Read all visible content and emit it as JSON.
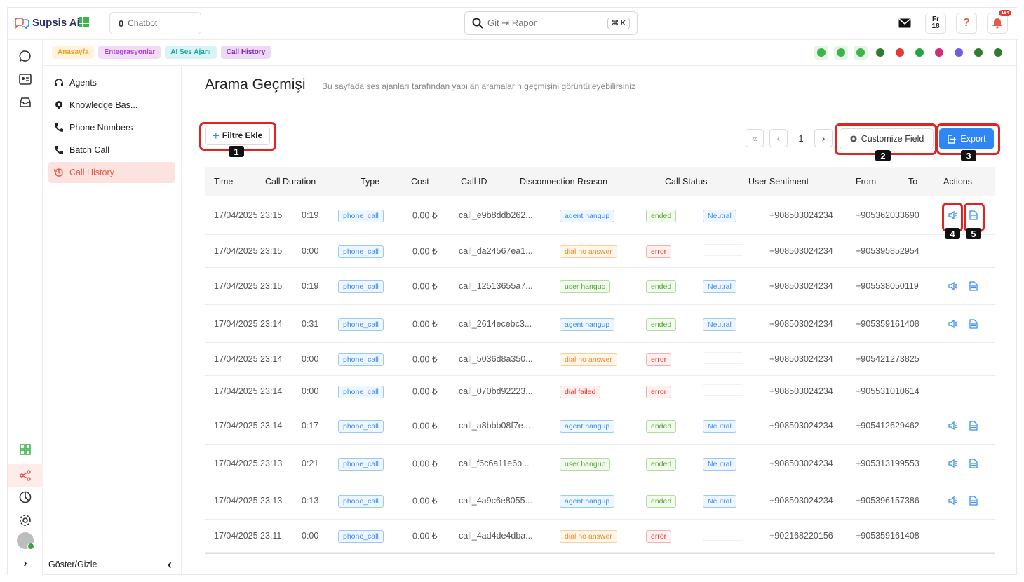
{
  "header": {
    "brand": "Supsis Ai",
    "chatbot_count": "0",
    "chatbot_label": "Chatbot",
    "search_placeholder": "Git ⇥ Rapor",
    "search_shortcut": "⌘ K",
    "lang_code": "Fr",
    "lang_count": "18",
    "notification_count": "164"
  },
  "breadcrumbs": [
    {
      "label": "Anasayfa",
      "color": "#f0a020",
      "bg": "#fff3d9"
    },
    {
      "label": "Entegrasyonlar",
      "color": "#b341d0",
      "bg": "#f3dcf8"
    },
    {
      "label": "AI Ses Ajanı",
      "color": "#1ba2a6",
      "bg": "#d9f4f4"
    },
    {
      "label": "Call History",
      "color": "#8a2bb5",
      "bg": "#ecd8f7"
    }
  ],
  "channel_icons": [
    "chatbot-icon",
    "list-icon",
    "voice-agent-icon",
    "wifi-icon",
    "telegram-icon",
    "whatsapp-icon",
    "instagram-icon",
    "messenger-icon",
    "sms-icon",
    "livechat-icon"
  ],
  "sidebar": {
    "items": [
      {
        "label": "Agents",
        "icon": "headset-icon"
      },
      {
        "label": "Knowledge Bas...",
        "icon": "brain-icon"
      },
      {
        "label": "Phone Numbers",
        "icon": "phone-icon"
      },
      {
        "label": "Batch Call",
        "icon": "phone-icon"
      },
      {
        "label": "Call History",
        "icon": "history-icon"
      }
    ],
    "toggle_label": "Göster/Gizle"
  },
  "page": {
    "title": "Arama Geçmişi",
    "subtitle": "Bu sayfada ses ajanları tarafından yapılan aramaların geçmişini görüntüleyebilirsiniz",
    "filter_button": "Filtre Ekle",
    "current_page": "1",
    "customize_button": "Customize Field",
    "export_button": "Export"
  },
  "markers": [
    "1",
    "2",
    "3",
    "4",
    "5"
  ],
  "table": {
    "columns": [
      "Time",
      "Call Duration",
      "Type",
      "Cost",
      "Call ID",
      "Disconnection Reason",
      "Call Status",
      "User Sentiment",
      "From",
      "To",
      "Actions"
    ],
    "rows": [
      {
        "time": "17/04/2025 23:15",
        "duration": "0:19",
        "type": "phone_call",
        "cost": "0.00 ₺",
        "call_id": "call_e9b8ddb262...",
        "reason": "agent hangup",
        "reason_color": "blue",
        "status": "ended",
        "status_color": "green",
        "sentiment": "Neutral",
        "from": "+908503024234",
        "to": "+905362033690",
        "actions": true
      },
      {
        "time": "17/04/2025 23:15",
        "duration": "0:00",
        "type": "phone_call",
        "cost": "0.00 ₺",
        "call_id": "call_da24567ea1...",
        "reason": "dial no answer",
        "reason_color": "orange",
        "status": "error",
        "status_color": "red",
        "sentiment": "",
        "from": "+908503024234",
        "to": "+905395852954",
        "actions": false
      },
      {
        "time": "17/04/2025 23:15",
        "duration": "0:19",
        "type": "phone_call",
        "cost": "0.00 ₺",
        "call_id": "call_12513655a7...",
        "reason": "user hangup",
        "reason_color": "green",
        "status": "ended",
        "status_color": "green",
        "sentiment": "Neutral",
        "from": "+908503024234",
        "to": "+905538050119",
        "actions": true
      },
      {
        "time": "17/04/2025 23:14",
        "duration": "0:31",
        "type": "phone_call",
        "cost": "0.00 ₺",
        "call_id": "call_2614ecebc3...",
        "reason": "agent hangup",
        "reason_color": "blue",
        "status": "ended",
        "status_color": "green",
        "sentiment": "Neutral",
        "from": "+908503024234",
        "to": "+905359161408",
        "actions": true
      },
      {
        "time": "17/04/2025 23:14",
        "duration": "0:00",
        "type": "phone_call",
        "cost": "0.00 ₺",
        "call_id": "call_5036d8a350...",
        "reason": "dial no answer",
        "reason_color": "orange",
        "status": "error",
        "status_color": "red",
        "sentiment": "",
        "from": "+908503024234",
        "to": "+905421273825",
        "actions": false
      },
      {
        "time": "17/04/2025 23:14",
        "duration": "0:00",
        "type": "phone_call",
        "cost": "0.00 ₺",
        "call_id": "call_070bd92223...",
        "reason": "dial failed",
        "reason_color": "red",
        "status": "error",
        "status_color": "red",
        "sentiment": "",
        "from": "+908503024234",
        "to": "+905531010614",
        "actions": false
      },
      {
        "time": "17/04/2025 23:14",
        "duration": "0:17",
        "type": "phone_call",
        "cost": "0.00 ₺",
        "call_id": "call_a8bbb08f7e...",
        "reason": "agent hangup",
        "reason_color": "blue",
        "status": "ended",
        "status_color": "green",
        "sentiment": "Neutral",
        "from": "+908503024234",
        "to": "+905412629462",
        "actions": true
      },
      {
        "time": "17/04/2025 23:13",
        "duration": "0:21",
        "type": "phone_call",
        "cost": "0.00 ₺",
        "call_id": "call_f6c6a11e6b...",
        "reason": "user hangup",
        "reason_color": "green",
        "status": "ended",
        "status_color": "green",
        "sentiment": "Neutral",
        "from": "+908503024234",
        "to": "+905313199553",
        "actions": true
      },
      {
        "time": "17/04/2025 23:13",
        "duration": "0:13",
        "type": "phone_call",
        "cost": "0.00 ₺",
        "call_id": "call_4a9c6e8055...",
        "reason": "agent hangup",
        "reason_color": "blue",
        "status": "ended",
        "status_color": "green",
        "sentiment": "Neutral",
        "from": "+908503024234",
        "to": "+905396157386",
        "actions": true
      },
      {
        "time": "17/04/2025 23:11",
        "duration": "0:00",
        "type": "phone_call",
        "cost": "0.00 ₺",
        "call_id": "call_4ad4de4dba...",
        "reason": "dial no answer",
        "reason_color": "orange",
        "status": "error",
        "status_color": "red",
        "sentiment": "",
        "from": "+902168220156",
        "to": "+905359161408",
        "actions": false
      }
    ]
  },
  "colors": {
    "accent": "#e45a4a",
    "primary_button": "#2f87f5",
    "highlight": "#e02424"
  }
}
